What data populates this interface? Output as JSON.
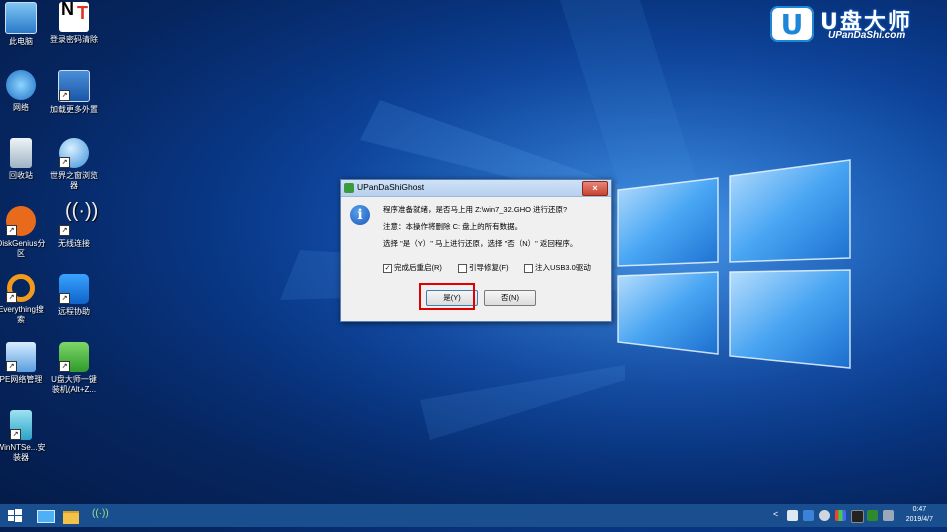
{
  "brand": {
    "name": "U盘大师",
    "url": "UPanDaShi.com",
    "logo_letter": "U"
  },
  "desktop_icons": [
    {
      "label": "此电脑"
    },
    {
      "label": "登录密码清除"
    },
    {
      "label": "网络"
    },
    {
      "label": "加载更多外置"
    },
    {
      "label": "回收站"
    },
    {
      "label": "世界之窗浏览器"
    },
    {
      "label": "DiskGenius分区"
    },
    {
      "label": "无线连接"
    },
    {
      "label": "Everything搜索"
    },
    {
      "label": "远程协助"
    },
    {
      "label": "PE网络管理"
    },
    {
      "label": "U盘大师一键装机(Alt+Z..."
    },
    {
      "label": "WinNTSe...安装器"
    }
  ],
  "dialog": {
    "title": "UPanDaShiGhost",
    "close": "×",
    "info_glyph": "i",
    "line1": "程序准备就绪，是否马上用 Z:\\win7_32.GHO 进行还原?",
    "line2": "注意：本操作将删除 C: 盘上的所有数据。",
    "line3": "选择 \"是（Y）\" 马上进行还原，选择 \"否（N）\" 返回程序。",
    "checkboxes": [
      {
        "label": "完成后重启(R)",
        "checked": true
      },
      {
        "label": "引导修复(F)",
        "checked": false
      },
      {
        "label": "注入USB3.0驱动",
        "checked": false
      }
    ],
    "yes_label": "是(Y)",
    "no_label": "否(N)"
  },
  "taskbar": {
    "clock_time": "0:47",
    "clock_date": "2019/4/7",
    "tray_chevron": "<"
  },
  "colors": {
    "accent": "#1a4f8f",
    "highlight": "#e00000"
  }
}
